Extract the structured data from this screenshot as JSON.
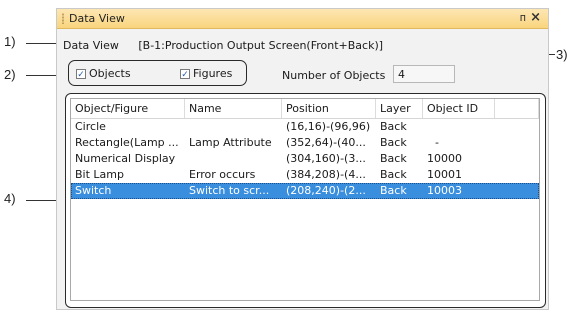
{
  "window": {
    "title": "Data View",
    "pin_glyph": "ᴨ",
    "close_glyph": "×"
  },
  "screen": {
    "label": "Data View",
    "value": "[B-1:Production Output Screen(Front+Back)]"
  },
  "filters": {
    "objects_label": "Objects",
    "objects_checked": true,
    "figures_label": "Figures",
    "figures_checked": true
  },
  "count": {
    "label": "Number of Objects",
    "value": "4"
  },
  "table": {
    "columns": [
      "Object/Figure",
      "Name",
      "Position",
      "Layer",
      "Object ID",
      ""
    ],
    "rows": [
      [
        "Circle",
        "",
        "(16,16)-(96,96)",
        "Back",
        ""
      ],
      [
        "Rectangle(Lamp ...",
        "Lamp Attribute",
        "(352,64)-(40...",
        "Back",
        "-"
      ],
      [
        "Numerical Display",
        "",
        "(304,160)-(3...",
        "Back",
        "10000"
      ],
      [
        "Bit Lamp",
        "Error occurs",
        "(384,208)-(4...",
        "Back",
        "10001"
      ],
      [
        "Switch",
        "Switch to scr...",
        "(208,240)-(2...",
        "Back",
        "10003"
      ]
    ],
    "selected_index": 4
  },
  "callouts": [
    "1)",
    "2)",
    "3)",
    "4)"
  ],
  "colors": {
    "selection": "#3a8ede",
    "titlebar": "#f9d57e"
  }
}
